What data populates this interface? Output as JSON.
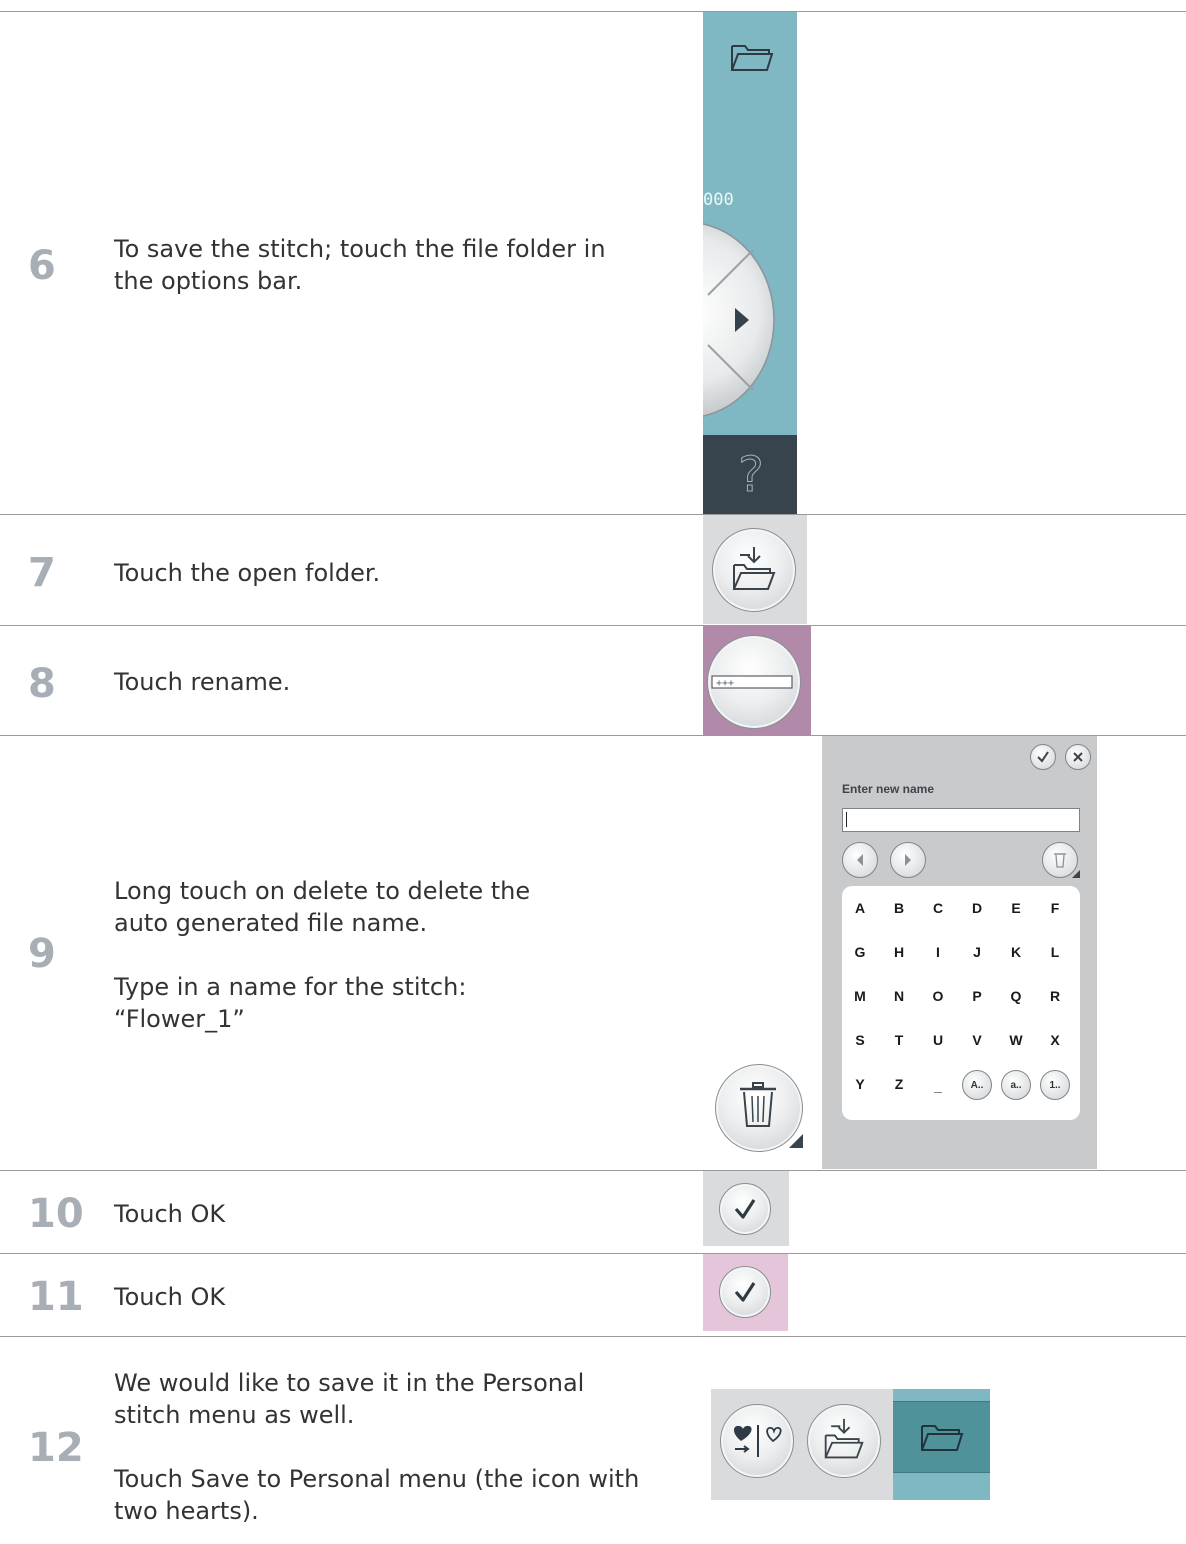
{
  "steps": [
    {
      "number": "6",
      "paragraphs": [
        "To save the stitch; touch the file folder in the options bar."
      ]
    },
    {
      "number": "7",
      "paragraphs": [
        "Touch the open folder."
      ]
    },
    {
      "number": "8",
      "paragraphs": [
        "Touch rename."
      ]
    },
    {
      "number": "9",
      "paragraphs": [
        "Long touch on delete to delete the auto generated file name.",
        "Type in a name for the stitch: “Flower_1”"
      ]
    },
    {
      "number": "10",
      "paragraphs": [
        "Touch OK"
      ]
    },
    {
      "number": "11",
      "paragraphs": [
        "Touch OK"
      ]
    },
    {
      "number": "12",
      "paragraphs": [
        "We would like to save it in the Personal stitch menu as well.",
        "Touch Save to Personal menu (the icon with two hearts)."
      ]
    }
  ],
  "options_bar": {
    "counter_text": "000",
    "help_symbol": "?",
    "icons": [
      "folder-icon",
      "play-arrow-icon",
      "help-icon"
    ]
  },
  "rename_dialog": {
    "label": "Enter new name",
    "input_value": "",
    "keys_rows": [
      [
        "A",
        "B",
        "C",
        "D",
        "E",
        "F"
      ],
      [
        "G",
        "H",
        "I",
        "J",
        "K",
        "L"
      ],
      [
        "M",
        "N",
        "O",
        "P",
        "Q",
        "R"
      ],
      [
        "S",
        "T",
        "U",
        "V",
        "W",
        "X"
      ],
      [
        "Y",
        "Z",
        "_"
      ]
    ],
    "mode_keys": [
      "A..",
      "a..",
      "1.."
    ]
  },
  "colors": {
    "teal": "#7fb8c2",
    "dark_teal": "#4f9299",
    "dark_slate": "#37434d",
    "mauve": "#b08aa8",
    "pink": "#e4c5da",
    "light_gray": "#d9dbdc",
    "dialog_gray": "#c8cacc"
  }
}
